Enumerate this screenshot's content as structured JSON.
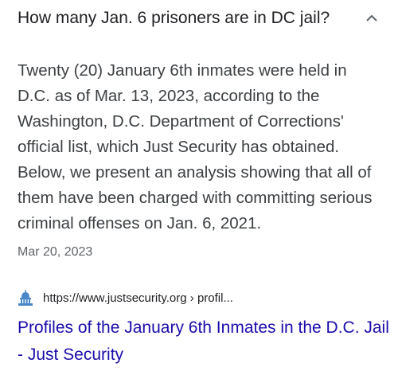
{
  "question": {
    "text": "How many Jan. 6 prisoners are in DC jail?",
    "toggle_icon": "chevron-up-icon"
  },
  "answer": {
    "text": "Twenty (20) January 6th inmates were held in D.C. as of Mar. 13, 2023, according to the Washington, D.C. Department of Corrections' official list, which Just Security has obtained. Below, we present an analysis showing that all of them have been charged with committing serious criminal offenses on Jan. 6, 2021.",
    "date": "Mar 20, 2023"
  },
  "source": {
    "favicon": "capitol-building-icon",
    "url": "https://www.justsecurity.org › profil...",
    "title": "Profiles of the January 6th Inmates in the D.C. Jail - Just Security"
  },
  "colors": {
    "link": "#1a0dab",
    "favicon": "#4a86c8"
  }
}
